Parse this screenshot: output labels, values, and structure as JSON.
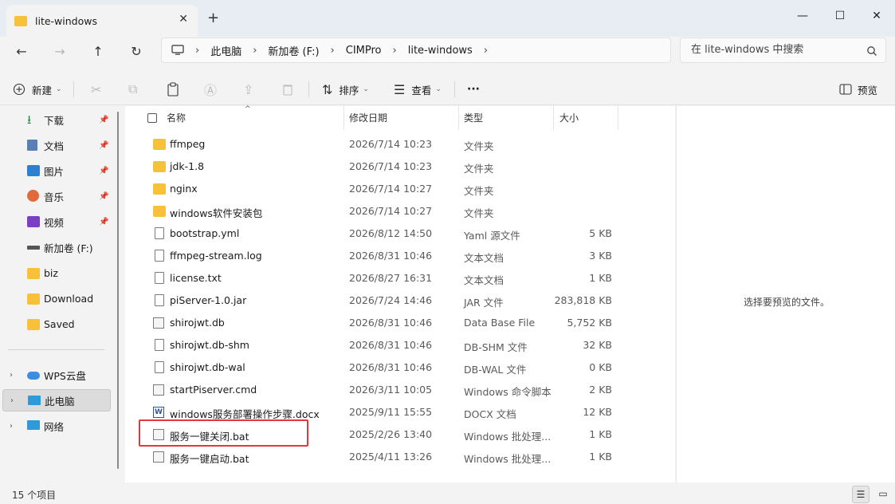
{
  "window": {
    "tab_title": "lite-windows",
    "tab_close": "✕",
    "new_tab": "+",
    "minimize": "—",
    "maximize": "☐",
    "close": "✕"
  },
  "nav": {
    "back": "←",
    "forward": "→",
    "up": "↑",
    "refresh": "↻",
    "breadcrumb": [
      "此电脑",
      "新加卷 (F:)",
      "CIMPro",
      "lite-windows"
    ],
    "search_placeholder": "在 lite-windows 中搜索"
  },
  "toolbar": {
    "new_label": "新建",
    "sort_label": "排序",
    "view_label": "查看",
    "more": "···",
    "preview_label": "预览"
  },
  "sidebar": {
    "items": [
      {
        "label": "下载",
        "icon": "download-icon",
        "pinned": true
      },
      {
        "label": "文档",
        "icon": "documents-icon",
        "pinned": true
      },
      {
        "label": "图片",
        "icon": "pictures-icon",
        "pinned": true
      },
      {
        "label": "音乐",
        "icon": "music-icon",
        "pinned": true
      },
      {
        "label": "视频",
        "icon": "videos-icon",
        "pinned": true
      },
      {
        "label": "新加卷 (F:)",
        "icon": "drive-icon",
        "pinned": false
      },
      {
        "label": "biz",
        "icon": "folder-icon",
        "pinned": false
      },
      {
        "label": "Download",
        "icon": "folder-icon",
        "pinned": false
      },
      {
        "label": "Saved",
        "icon": "folder-icon",
        "pinned": false
      }
    ],
    "groups": [
      {
        "label": "WPS云盘",
        "icon": "cloud-icon"
      },
      {
        "label": "此电脑",
        "icon": "computer-icon",
        "selected": true
      },
      {
        "label": "网络",
        "icon": "network-icon"
      }
    ]
  },
  "columns": {
    "name": "名称",
    "date": "修改日期",
    "type": "类型",
    "size": "大小"
  },
  "files": [
    {
      "name": "ffmpeg",
      "date": "2026/7/14 10:23",
      "type": "文件夹",
      "size": "",
      "icon": "folder-icon"
    },
    {
      "name": "jdk-1.8",
      "date": "2026/7/14 10:23",
      "type": "文件夹",
      "size": "",
      "icon": "folder-icon"
    },
    {
      "name": "nginx",
      "date": "2026/7/14 10:27",
      "type": "文件夹",
      "size": "",
      "icon": "folder-icon"
    },
    {
      "name": "windows软件安装包",
      "date": "2026/7/14 10:27",
      "type": "文件夹",
      "size": "",
      "icon": "folder-icon"
    },
    {
      "name": "bootstrap.yml",
      "date": "2026/8/12 14:50",
      "type": "Yaml 源文件",
      "size": "5 KB",
      "icon": "document-icon"
    },
    {
      "name": "ffmpeg-stream.log",
      "date": "2026/8/31 10:46",
      "type": "文本文档",
      "size": "3 KB",
      "icon": "text-file-icon"
    },
    {
      "name": "license.txt",
      "date": "2026/8/27 16:31",
      "type": "文本文档",
      "size": "1 KB",
      "icon": "text-file-icon"
    },
    {
      "name": "piServer-1.0.jar",
      "date": "2026/7/24 14:46",
      "type": "JAR 文件",
      "size": "283,818 KB",
      "icon": "document-icon"
    },
    {
      "name": "shirojwt.db",
      "date": "2026/8/31 10:46",
      "type": "Data Base File",
      "size": "5,752 KB",
      "icon": "settings-file-icon"
    },
    {
      "name": "shirojwt.db-shm",
      "date": "2026/8/31 10:46",
      "type": "DB-SHM 文件",
      "size": "32 KB",
      "icon": "document-icon"
    },
    {
      "name": "shirojwt.db-wal",
      "date": "2026/8/31 10:46",
      "type": "DB-WAL 文件",
      "size": "0 KB",
      "icon": "document-icon"
    },
    {
      "name": "startPiserver.cmd",
      "date": "2026/3/11 10:05",
      "type": "Windows 命令脚本",
      "size": "2 KB",
      "icon": "script-icon"
    },
    {
      "name": "windows服务部署操作步骤.docx",
      "date": "2025/9/11 15:55",
      "type": "DOCX 文档",
      "size": "12 KB",
      "icon": "word-icon"
    },
    {
      "name": "服务一键关闭.bat",
      "date": "2025/2/26 13:40",
      "type": "Windows 批处理...",
      "size": "1 KB",
      "icon": "script-icon"
    },
    {
      "name": "服务一键启动.bat",
      "date": "2025/4/11 13:26",
      "type": "Windows 批处理...",
      "size": "1 KB",
      "icon": "script-icon"
    }
  ],
  "preview": {
    "message": "选择要预览的文件。"
  },
  "status": {
    "item_count": "15 个项目"
  },
  "colors": {
    "folder": "#f8c13a",
    "highlight": "#e0383e",
    "titlebar": "#e8ecf3"
  }
}
